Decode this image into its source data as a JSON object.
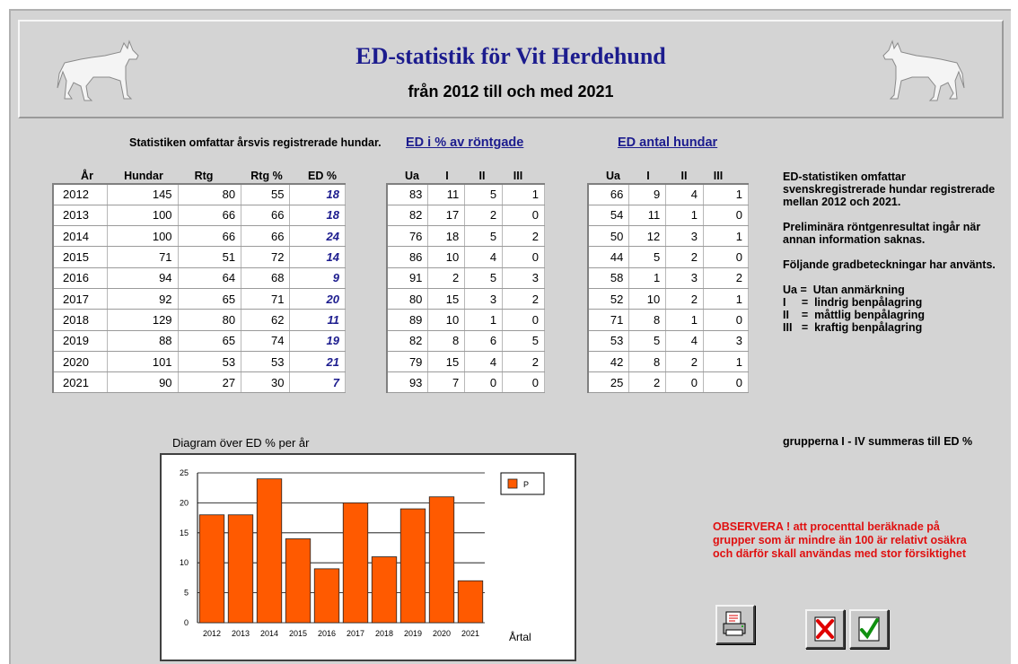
{
  "header": {
    "title": "ED-statistik för Vit Herdehund",
    "subtitle": "från 2012 till och med 2021"
  },
  "main": {
    "description": "Statistiken omfattar årsvis registrerade hundar.",
    "columns": [
      "År",
      "Hundar",
      "Rtg",
      "Rtg %",
      "ED %"
    ],
    "rows": [
      [
        "2012",
        "145",
        "80",
        "55",
        "18"
      ],
      [
        "2013",
        "100",
        "66",
        "66",
        "18"
      ],
      [
        "2014",
        "100",
        "66",
        "66",
        "24"
      ],
      [
        "2015",
        "71",
        "51",
        "72",
        "14"
      ],
      [
        "2016",
        "94",
        "64",
        "68",
        "9"
      ],
      [
        "2017",
        "92",
        "65",
        "71",
        "20"
      ],
      [
        "2018",
        "129",
        "80",
        "62",
        "11"
      ],
      [
        "2019",
        "88",
        "65",
        "74",
        "19"
      ],
      [
        "2020",
        "101",
        "53",
        "53",
        "21"
      ],
      [
        "2021",
        "90",
        "27",
        "30",
        "7"
      ]
    ]
  },
  "ed_percent": {
    "title": "ED i %  av röntgade",
    "columns": [
      "Ua",
      "I",
      "II",
      "III"
    ],
    "rows": [
      [
        "83",
        "11",
        "5",
        "1"
      ],
      [
        "82",
        "17",
        "2",
        "0"
      ],
      [
        "76",
        "18",
        "5",
        "2"
      ],
      [
        "86",
        "10",
        "4",
        "0"
      ],
      [
        "91",
        "2",
        "5",
        "3"
      ],
      [
        "80",
        "15",
        "3",
        "2"
      ],
      [
        "89",
        "10",
        "1",
        "0"
      ],
      [
        "82",
        "8",
        "6",
        "5"
      ],
      [
        "79",
        "15",
        "4",
        "2"
      ],
      [
        "93",
        "7",
        "0",
        "0"
      ]
    ]
  },
  "ed_count": {
    "title": "ED antal hundar",
    "columns": [
      "Ua",
      "I",
      "II",
      "III"
    ],
    "rows": [
      [
        "66",
        "9",
        "4",
        "1"
      ],
      [
        "54",
        "11",
        "1",
        "0"
      ],
      [
        "50",
        "12",
        "3",
        "1"
      ],
      [
        "44",
        "5",
        "2",
        "0"
      ],
      [
        "58",
        "1",
        "3",
        "2"
      ],
      [
        "52",
        "10",
        "2",
        "1"
      ],
      [
        "71",
        "8",
        "1",
        "0"
      ],
      [
        "53",
        "5",
        "4",
        "3"
      ],
      [
        "42",
        "8",
        "2",
        "1"
      ],
      [
        "25",
        "2",
        "0",
        "0"
      ]
    ]
  },
  "side": {
    "p1": "ED-statistiken omfattar svenskregistrerade hundar registrerade mellan 2012 och 2021.",
    "p2": "Preliminära röntgenresultat ingår när annan information saknas.",
    "p3": "Följande gradbeteckningar har använts.",
    "legend": [
      "Ua =  Utan anmärkning",
      "I     =  lindrig benpålagring",
      "II    =  måttlig benpålagring",
      "III   =  kraftig benpålagring"
    ],
    "sum_note": "grupperna I - IV summeras till ED %",
    "warning": "OBSERVERA ! att procenttal beräknade på grupper som är mindre än 100 är relativt osäkra och därför skall användas med stor försiktighet"
  },
  "chart_caption": "Diagram över ED % per år",
  "chart_data": {
    "type": "bar",
    "categories": [
      "2012",
      "2013",
      "2014",
      "2015",
      "2016",
      "2017",
      "2018",
      "2019",
      "2020",
      "2021"
    ],
    "series": [
      {
        "name": "P",
        "values": [
          18,
          18,
          24,
          14,
          9,
          20,
          11,
          19,
          21,
          7
        ]
      }
    ],
    "xlabel": "Årtal",
    "ylabel": "",
    "ylim": [
      0,
      25
    ],
    "yticks": [
      0,
      5,
      10,
      15,
      20,
      25
    ],
    "grid": true,
    "legend": "top-right",
    "bar_color": "#ff5a00"
  },
  "buttons": {
    "print": "printer-icon",
    "cancel": "red-x-icon",
    "ok": "green-check-icon"
  },
  "colors": {
    "title": "#1c1c8e",
    "warning": "#e01010",
    "bar": "#ff5a00",
    "panel": "#d4d4d4"
  }
}
